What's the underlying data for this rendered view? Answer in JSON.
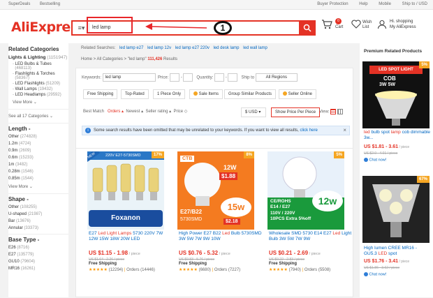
{
  "topbar": {
    "left": [
      "SuperDeals",
      "Bestselling"
    ],
    "right": [
      "Buyer Protection",
      "Help",
      "Mobile",
      "Ship to / USD"
    ]
  },
  "header": {
    "logo": "AliExpress",
    "search_value": "led lamp",
    "annotation_number": "1",
    "cart_label": "Cart",
    "cart_count": "0",
    "wish_label": "Wish\nList",
    "account_greeting": "Hi. shopping",
    "account_label": "My AliExpress"
  },
  "sidebar": {
    "title": "Related Categories",
    "main_cat": "Lights & Lighting",
    "main_count": "(1151947)",
    "subs": [
      {
        "label": "LED Bulbs & Tubes",
        "count": "(468113)"
      },
      {
        "label": "Flashlights & Torches",
        "count": "(58367)"
      },
      {
        "label": "LED Flashlights",
        "count": "(51209)"
      },
      {
        "label": "Wall Lamps",
        "count": "(19432)"
      },
      {
        "label": "LED Headlamps",
        "count": "(29592)"
      }
    ],
    "view_more": "View More",
    "see_all": "See all 17 Categories",
    "length_title": "Length",
    "length_opts": [
      {
        "label": "Other",
        "count": "(274828)"
      },
      {
        "label": "1.2m",
        "count": "(4724)"
      },
      {
        "label": "0.9m",
        "count": "(2609)"
      },
      {
        "label": "0.6m",
        "count": "(15233)"
      },
      {
        "label": "1m",
        "count": "(3482)"
      },
      {
        "label": "0.28m",
        "count": "(1546)"
      },
      {
        "label": "0.85m",
        "count": "(1544)"
      }
    ],
    "shape_title": "Shape",
    "shape_opts": [
      {
        "label": "Other",
        "count": "(108255)"
      },
      {
        "label": "U-shaped",
        "count": "(21987)"
      },
      {
        "label": "Bar",
        "count": "(13676)"
      },
      {
        "label": "Annular",
        "count": "(33373)"
      }
    ],
    "base_title": "Base Type",
    "base_opts": [
      {
        "label": "E26",
        "count": "(8716)"
      },
      {
        "label": "E27",
        "count": "(135779)"
      },
      {
        "label": "GU10",
        "count": "(79604)"
      },
      {
        "label": "MR16",
        "count": "(16261)"
      }
    ]
  },
  "main": {
    "related_label": "Related Searches:",
    "related": [
      "led lamp e27",
      "led lamp 12v",
      "led lamp e27 220v",
      "led desk lamp",
      "led wall lamp"
    ],
    "breadcrumb": "Home > All Categories > \"led lamp\" ",
    "result_count": "111,426",
    "result_label": "Results",
    "keywords_label": "Keywords:",
    "keywords_value": "led lamp",
    "price_label": "Price:",
    "quantity_label": "Quantity:",
    "ship_label": "Ship to",
    "ship_value": "All Regions",
    "filters": [
      "Free Shipping",
      "Top-Rated",
      "1 Piece Only",
      "Sale Items",
      "Group Similar Products",
      "Seller Online"
    ],
    "sort_label": "Best Match",
    "sorts": [
      "Orders",
      "Newest",
      "Seller rating",
      "Price"
    ],
    "currency": "$ USD",
    "price_piece": "Show Price Per Piece",
    "view_label": "View:",
    "notice": "Some search results have been omitted that may be unrelated to your keywords. If you want to view all results,",
    "notice_link": "click here"
  },
  "products": [
    {
      "title_pre": "E27 ",
      "title_hl": "Led Light Lamps",
      "title_post": " 5730 220V 7W 12W 15W 18W 20W LED",
      "price": "US $1.15 - 1.98",
      "unit": " / piece",
      "old": "US $1.64 - 2.26 / piece",
      "ship": "Free Shipping",
      "stars": "★★★★★",
      "reviews": "(12294)",
      "orders": "Orders (14446)",
      "discount": "17%",
      "banner": "220V E27-5730SMD",
      "brand": "Foxanon"
    },
    {
      "title_pre": "High Power E27 B22 ",
      "title_hl": "Led",
      "title_post": " Bulb 5730SMD 3W 5W 7W 9W 10W",
      "price": "US $0.76 - 5.32",
      "unit": " / piece",
      "old": "US $0.83 - 5.76 / piece",
      "ship": "Free Shipping",
      "stars": "★★★★★",
      "reviews": "(6680)",
      "orders": "Orders (7227)",
      "discount": "8%",
      "brand": "CTB",
      "watt": "12W",
      "promo": "$1.88",
      "base": "E27/B22",
      "smd": "5730SMD",
      "watt2": "15w",
      "promo2": "$2.18"
    },
    {
      "title_pre": "Wholesale SMD 5730 E14 E27 ",
      "title_hl": "Led",
      "title_post": " Light Bulb 3W 5W 7W 9W",
      "price": "US $0.21 - 2.69",
      "unit": " / piece",
      "old": "US $0.22 - 2.83 / piece",
      "ship": "Free Shipping",
      "stars": "★★★★★",
      "reviews": "(7940)",
      "orders": "Orders (5508)",
      "discount": "5%",
      "certs": "CE/ROHS",
      "sockets": "E14 / E27",
      "voltage": "110V / 220V",
      "pack": "10PCS Extra 5%off",
      "watt": "12w"
    }
  ],
  "premium": {
    "title": "Premium Related Products",
    "items": [
      {
        "title_pre": "",
        "title_hl": "led",
        "title_mid": " bulb spot ",
        "title_hl2": "lamp",
        "title_post": " cob dimmable 3w...",
        "price": "US $1.81 - 3.61",
        "unit": " / piece",
        "old": "US $2.0 - 4.01 / piece",
        "chat": "Chat now!",
        "discount": "5%",
        "label1": "LED SPOT LIGHT",
        "label2": "COB",
        "label3": "3W 5W"
      },
      {
        "title_pre": "High lumen CREE MR16 - GU5.3 ",
        "title_hl": "LED",
        "title_mid": " spot ",
        "title_hl2": "",
        "title_post": "",
        "price": "US $1.76 - 3.41",
        "unit": " / piece",
        "old": "US $1.86 - 3.62 / piece",
        "chat": "Chat now!",
        "discount": "67%"
      }
    ]
  }
}
